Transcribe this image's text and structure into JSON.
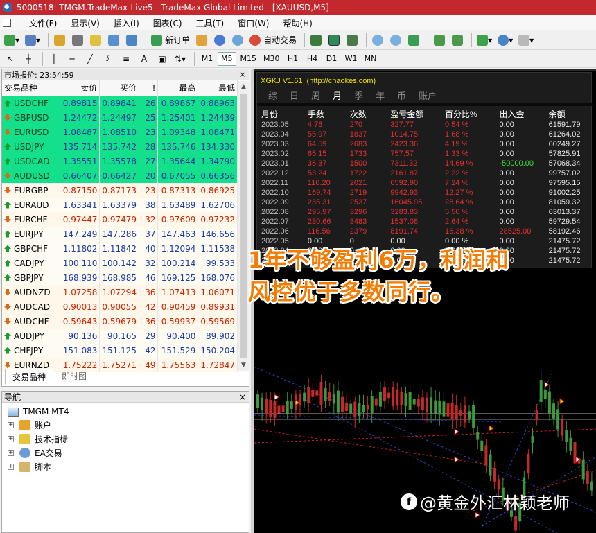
{
  "window": {
    "title": "5000518: TMGM.TradeMax-Live5 - TradeMax Global Limited - [XAUUSD,M5]"
  },
  "menu": [
    "文件(F)",
    "显示(V)",
    "插入(I)",
    "图表(C)",
    "工具(T)",
    "窗口(W)",
    "帮助(H)"
  ],
  "toolbar": {
    "new_order": "新订单",
    "auto_trading": "自动交易"
  },
  "draw_tools": {
    "text_tool": "A"
  },
  "timeframes": [
    "M1",
    "M5",
    "M15",
    "M30",
    "H1",
    "H4",
    "D1",
    "W1",
    "MN"
  ],
  "active_timeframe": "M5",
  "market_watch": {
    "title": "市场报价: 23:54:59",
    "columns": [
      "交易品种",
      "卖价",
      "买价",
      "!",
      "最高",
      "最低"
    ],
    "rows": [
      {
        "symbol": "USDCHF",
        "bid": "0.89815",
        "ask": "0.89841",
        "spread": "26",
        "high": "0.89867",
        "low": "0.88963",
        "dir": "up",
        "style": "green"
      },
      {
        "symbol": "GBPUSD",
        "bid": "1.24472",
        "ask": "1.24497",
        "spread": "25",
        "high": "1.25401",
        "low": "1.24439",
        "dir": "down",
        "style": "green"
      },
      {
        "symbol": "EURUSD",
        "bid": "1.08487",
        "ask": "1.08510",
        "spread": "23",
        "high": "1.09348",
        "low": "1.08471",
        "dir": "down",
        "style": "green"
      },
      {
        "symbol": "USDJPY",
        "bid": "135.714",
        "ask": "135.742",
        "spread": "28",
        "high": "135.746",
        "low": "134.330",
        "dir": "up",
        "style": "green"
      },
      {
        "symbol": "USDCAD",
        "bid": "1.35551",
        "ask": "1.35578",
        "spread": "27",
        "high": "1.35644",
        "low": "1.34790",
        "dir": "up",
        "style": "green"
      },
      {
        "symbol": "AUDUSD",
        "bid": "0.66407",
        "ask": "0.66427",
        "spread": "20",
        "high": "0.67055",
        "low": "0.66356",
        "dir": "down",
        "style": "green"
      },
      {
        "symbol": "EURGBP",
        "bid": "0.87150",
        "ask": "0.87173",
        "spread": "23",
        "high": "0.87313",
        "low": "0.86925",
        "dir": "down",
        "style": "down"
      },
      {
        "symbol": "EURAUD",
        "bid": "1.63341",
        "ask": "1.63379",
        "spread": "38",
        "high": "1.63489",
        "low": "1.62706",
        "dir": "up",
        "style": "up"
      },
      {
        "symbol": "EURCHF",
        "bid": "0.97447",
        "ask": "0.97479",
        "spread": "32",
        "high": "0.97609",
        "low": "0.97232",
        "dir": "down",
        "style": "down"
      },
      {
        "symbol": "EURJPY",
        "bid": "147.249",
        "ask": "147.286",
        "spread": "37",
        "high": "147.463",
        "low": "146.656",
        "dir": "up",
        "style": "up"
      },
      {
        "symbol": "GBPCHF",
        "bid": "1.11802",
        "ask": "1.11842",
        "spread": "40",
        "high": "1.12094",
        "low": "1.11538",
        "dir": "up",
        "style": "up"
      },
      {
        "symbol": "CADJPY",
        "bid": "100.110",
        "ask": "100.142",
        "spread": "32",
        "high": "100.214",
        "low": "99.533",
        "dir": "up",
        "style": "up"
      },
      {
        "symbol": "GBPJPY",
        "bid": "168.939",
        "ask": "168.985",
        "spread": "46",
        "high": "169.125",
        "low": "168.076",
        "dir": "up",
        "style": "up"
      },
      {
        "symbol": "AUDNZD",
        "bid": "1.07258",
        "ask": "1.07294",
        "spread": "36",
        "high": "1.07413",
        "low": "1.06071",
        "dir": "down",
        "style": "down"
      },
      {
        "symbol": "AUDCAD",
        "bid": "0.90013",
        "ask": "0.90055",
        "spread": "42",
        "high": "0.90459",
        "low": "0.89931",
        "dir": "down",
        "style": "down"
      },
      {
        "symbol": "AUDCHF",
        "bid": "0.59643",
        "ask": "0.59679",
        "spread": "36",
        "high": "0.59937",
        "low": "0.59569",
        "dir": "down",
        "style": "down"
      },
      {
        "symbol": "AUDJPY",
        "bid": "90.136",
        "ask": "90.165",
        "spread": "29",
        "high": "90.400",
        "low": "89.902",
        "dir": "up",
        "style": "up"
      },
      {
        "symbol": "CHFJPY",
        "bid": "151.083",
        "ask": "151.125",
        "spread": "42",
        "high": "151.529",
        "low": "150.204",
        "dir": "up",
        "style": "up"
      },
      {
        "symbol": "EURNZD",
        "bid": "1.75222",
        "ask": "1.75271",
        "spread": "49",
        "high": "1.75563",
        "low": "1.72847",
        "dir": "down",
        "style": "down"
      }
    ],
    "tabs": [
      "交易品种",
      "即时图"
    ]
  },
  "navigator": {
    "title": "导航",
    "root": "TMGM MT4",
    "items": [
      "账户",
      "技术指标",
      "EA交易",
      "脚本"
    ]
  },
  "indicator": {
    "name": "XGKJ V1.61",
    "url": "(http://chaokes.com)",
    "filters": [
      "综",
      "日",
      "周",
      "月",
      "季",
      "年",
      "币",
      "账户"
    ],
    "active_filter": "月",
    "headers": [
      "月份",
      "手数",
      "次数",
      "盈亏金额",
      "百分比%",
      "出入金",
      "余额"
    ],
    "rows": [
      [
        "2023.05",
        "4.78",
        "270",
        "327.77",
        "0.54 %",
        "0.00",
        "61591.79"
      ],
      [
        "2023.04",
        "55.97",
        "1837",
        "1014.75",
        "1.68 %",
        "0.00",
        "61264.02"
      ],
      [
        "2023.03",
        "64.59",
        "2683",
        "2423.36",
        "4.19 %",
        "0.00",
        "60249.27"
      ],
      [
        "2023.02",
        "65.15",
        "1733",
        "757.57",
        "1.33 %",
        "0.00",
        "57825.91"
      ],
      [
        "2023.01",
        "36.37",
        "1500",
        "7311.32",
        "14.69 %",
        "-50000.00",
        "57068.34"
      ],
      [
        "2022.12",
        "53.24",
        "1722",
        "2161.87",
        "2.22 %",
        "0.00",
        "99757.02"
      ],
      [
        "2022.11",
        "116.20",
        "2021",
        "6592.90",
        "7.24 %",
        "0.00",
        "97595.15"
      ],
      [
        "2022.10",
        "169.74",
        "2719",
        "9942.93",
        "12.27 %",
        "0.00",
        "91002.25"
      ],
      [
        "2022.09",
        "235.31",
        "2537",
        "16045.95",
        "28.64 %",
        "0.00",
        "81059.32"
      ],
      [
        "2022.08",
        "295.97",
        "3296",
        "3283.83",
        "5.50 %",
        "0.00",
        "63013.37"
      ],
      [
        "2022.07",
        "230.66",
        "3483",
        "1537.08",
        "2.64 %",
        "0.00",
        "59729.54"
      ],
      [
        "2022.06",
        "116.56",
        "2379",
        "8191.74",
        "16.38 %",
        "28525.00",
        "58192.46"
      ],
      [
        "2022.05",
        "0.00",
        "0",
        "0.00",
        "0.00 %",
        "0.00",
        "21475.72"
      ],
      [
        "2022.04",
        "0.00",
        "0",
        "0.00",
        "0.00 %",
        "0.00",
        "21475.72"
      ],
      [
        "2022.03",
        "0.00",
        "0",
        "0.00",
        "0.00 %",
        "0.00",
        "21475.72"
      ]
    ]
  },
  "overlay": {
    "line1": "1年不够盈利6万，利润和",
    "line2": "风控优于多数同行。"
  },
  "watermark": {
    "icon": "f",
    "text": "@黄金外汇林颖老师"
  },
  "colors": {
    "title_bar": "#c4282f",
    "green_row": "#14e08c",
    "loss": "#e53030",
    "overlay_text": "#f57c00"
  }
}
